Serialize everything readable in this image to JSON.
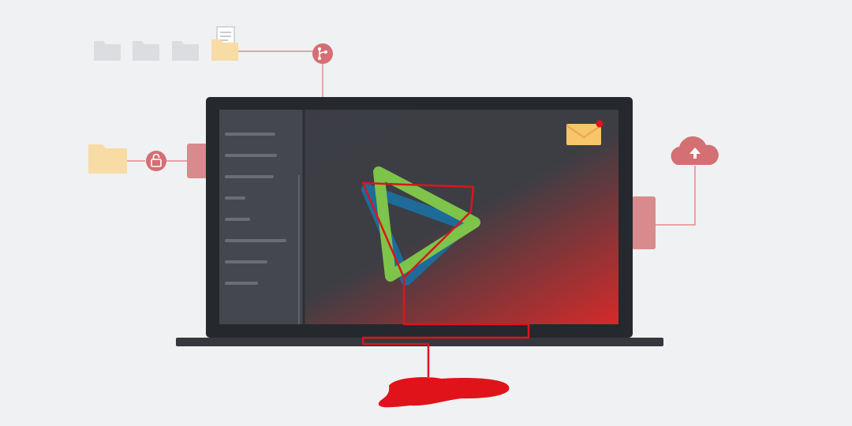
{
  "scene": {
    "background": "#f0f1f3",
    "elements": {
      "laptop": "laptop-outline",
      "screen": "dark-application-window",
      "sidebar": "menu-list",
      "logo": "play-triangle-logo",
      "email": "envelope-icon",
      "cloud": "cloud-upload-icon",
      "lock": "lock-icon",
      "share": "branch-share-icon",
      "folders": "folder-icons",
      "document": "document-icon",
      "spill": "red-liquid-puddle"
    }
  },
  "sidebar": {
    "item_count": 8
  },
  "notification": {
    "badge_visible": true
  },
  "colors": {
    "laptop_frame": "#25282d",
    "screen_bg": "#3a3d43",
    "sidebar_bg": "#44474d",
    "sidebar_line": "#6a6d72",
    "accent_red": "#e0131b",
    "connector": "#e48c8c",
    "icon_circle": "#d46f74",
    "folder_grey": "#dcdde0",
    "folder_yellow": "#f8dca6",
    "envelope": "#f7c56a",
    "logo_green": "#7ec34a",
    "logo_blue": "#1e6b9a"
  }
}
